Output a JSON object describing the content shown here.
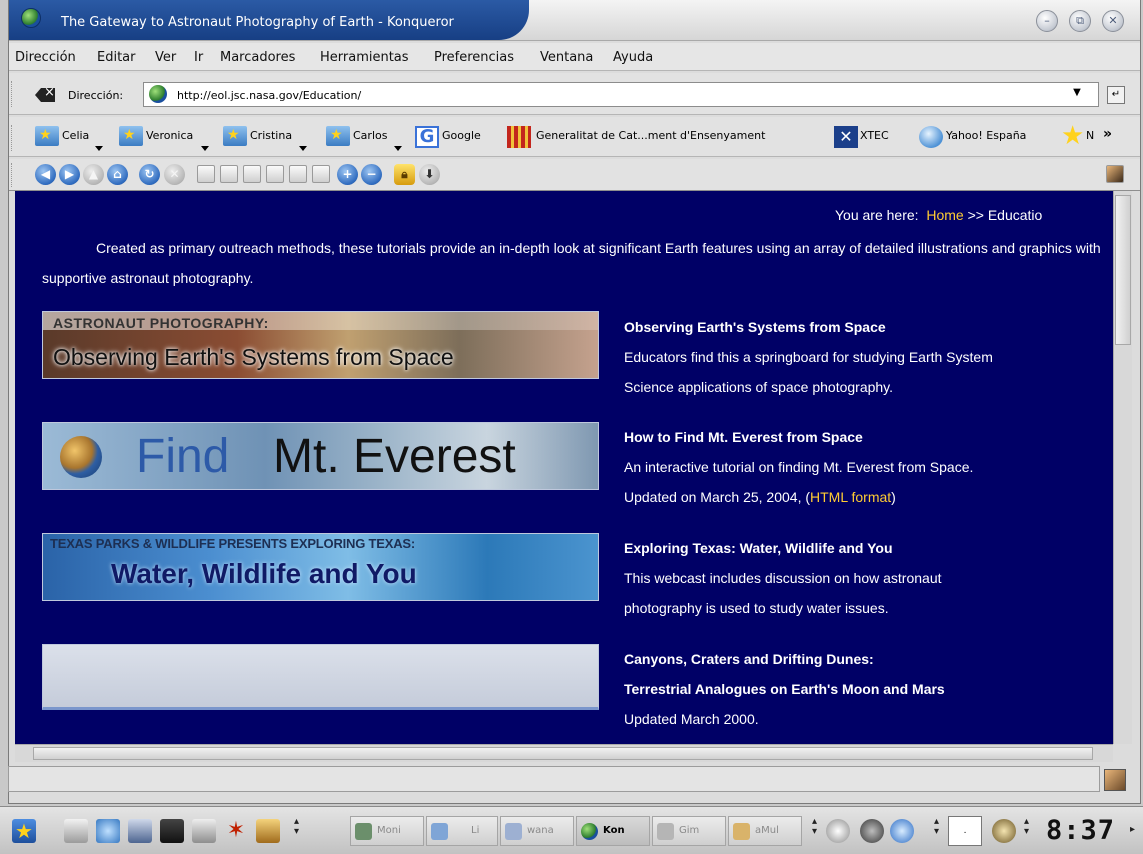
{
  "window": {
    "title": "The Gateway to Astronaut Photography of Earth - Konqueror"
  },
  "menubar": {
    "items": [
      "Dirección",
      "Editar",
      "Ver",
      "Ir",
      "Marcadores",
      "Herramientas",
      "Preferencias",
      "Ventana",
      "Ayuda"
    ]
  },
  "location": {
    "label": "Dirección:",
    "url": "http://eol.jsc.nasa.gov/Education/"
  },
  "bookmarks": {
    "items": [
      "Celia",
      "Veronica",
      "Cristina",
      "Carlos",
      "Google",
      "Generalitat de Cat...ment d'Ensenyament",
      "XTEC",
      "Yahoo! España",
      "N"
    ],
    "more": "»"
  },
  "page": {
    "breadcrumb_prefix": "You are here:",
    "breadcrumb_home": "Home",
    "breadcrumb_sep": ">>",
    "breadcrumb_current": "Educatio",
    "intro": "Created as primary outreach methods, these tutorials provide an in-depth look at significant Earth features using an array of detailed illustrations and graphics with supportive astronaut photography.",
    "entries": [
      {
        "banner_top": "ASTRONAUT PHOTOGRAPHY:",
        "banner_main": "Observing Earth's Systems from Space",
        "title": "Observing Earth's Systems from Space",
        "line1": "Educators find this a springboard for studying Earth System",
        "line2": "Science applications of space photography."
      },
      {
        "banner_word1": "Find",
        "banner_word2": "Mt. Everest",
        "title": "How to Find Mt. Everest from Space",
        "line1": "An interactive tutorial on finding Mt. Everest from Space.",
        "line2_prefix": "Updated on March 25, 2004, (",
        "line2_link": "HTML format",
        "line2_suffix": ")"
      },
      {
        "banner_top": "TEXAS PARKS & WILDLIFE PRESENTS EXPLORING TEXAS:",
        "banner_main": "Water, Wildlife and You",
        "title": "Exploring Texas: Water, Wildlife and You",
        "line1": "This webcast includes discussion on how astronaut",
        "line2": "photography is used to study water issues."
      },
      {
        "title": "Canyons, Craters and Drifting Dunes:",
        "title2": "Terrestrial Analogues on Earth's Moon and Mars",
        "line1": "Updated March 2000."
      }
    ]
  },
  "taskbar": {
    "tasks": [
      "Moni",
      "Li",
      "wana",
      "Kon",
      "Gim",
      "aMul"
    ],
    "clock": "8:37",
    "pager": "."
  },
  "colors": {
    "page_background": "#000066",
    "link": "#ffcc33",
    "title_bar": "#1d4a93"
  }
}
